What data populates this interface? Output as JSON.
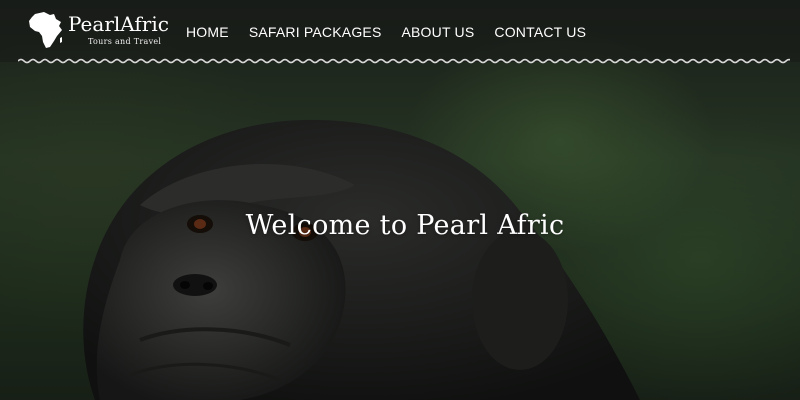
{
  "header": {
    "logo": {
      "name": "PearlAfric",
      "tagline": "Tours and Travel"
    },
    "nav": [
      {
        "label": "HOME"
      },
      {
        "label": "SAFARI PACKAGES"
      },
      {
        "label": "ABOUT US"
      },
      {
        "label": "CONTACT US"
      }
    ]
  },
  "hero": {
    "title": "Welcome to Pearl Afric",
    "image_subject": "chimpanzee"
  },
  "colors": {
    "header_bg": "#181a18",
    "text": "#ffffff",
    "background_green": "#253323"
  },
  "icons": {
    "logo_mark": "africa-map-icon"
  }
}
